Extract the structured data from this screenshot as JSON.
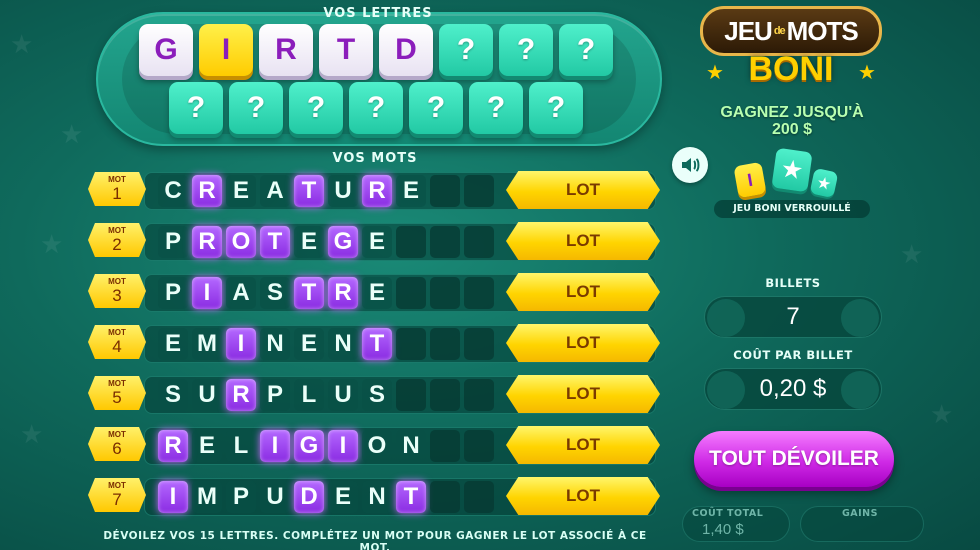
{
  "letters": {
    "title": "VOS LETTRES",
    "row1": [
      {
        "char": "G",
        "state": "revealed"
      },
      {
        "char": "I",
        "state": "gold"
      },
      {
        "char": "R",
        "state": "revealed"
      },
      {
        "char": "T",
        "state": "revealed"
      },
      {
        "char": "D",
        "state": "revealed"
      },
      {
        "char": "?",
        "state": "hidden"
      },
      {
        "char": "?",
        "state": "hidden"
      },
      {
        "char": "?",
        "state": "hidden"
      }
    ],
    "row2": [
      {
        "char": "?",
        "state": "hidden"
      },
      {
        "char": "?",
        "state": "hidden"
      },
      {
        "char": "?",
        "state": "hidden"
      },
      {
        "char": "?",
        "state": "hidden"
      },
      {
        "char": "?",
        "state": "hidden"
      },
      {
        "char": "?",
        "state": "hidden"
      },
      {
        "char": "?",
        "state": "hidden"
      }
    ]
  },
  "words": {
    "title": "VOS MOTS",
    "mot_label": "MOT",
    "lot_label": "LOT",
    "rows": [
      {
        "number": "1",
        "word": "CREATURE",
        "lit": [
          1,
          4,
          6
        ]
      },
      {
        "number": "2",
        "word": "PROTEGE",
        "lit": [
          1,
          2,
          3,
          5
        ]
      },
      {
        "number": "3",
        "word": "PIASTRE",
        "lit": [
          1,
          4,
          5
        ]
      },
      {
        "number": "4",
        "word": "EMINENT",
        "lit": [
          2,
          6
        ]
      },
      {
        "number": "5",
        "word": "SURPLUS",
        "lit": [
          2
        ]
      },
      {
        "number": "6",
        "word": "RELIGION",
        "lit": [
          0,
          3,
          4,
          5
        ]
      },
      {
        "number": "7",
        "word": "IMPUDENT",
        "lit": [
          0,
          4,
          7
        ]
      }
    ]
  },
  "instructions": "DÉVOILEZ VOS 15 LETTRES. COMPLÉTEZ UN MOT POUR GAGNER LE LOT ASSOCIÉ À CE MOT.",
  "logo": {
    "line1_a": "JEU",
    "line1_de": "de",
    "line1_b": "MOTS",
    "line2": "BONI"
  },
  "prize": {
    "line1": "GAGNEZ JUSQU'À",
    "line2": "200 $"
  },
  "bonus": {
    "label": "JEU BONI VERROUILLÉ"
  },
  "tickets": {
    "label": "BILLETS",
    "value": "7"
  },
  "cost": {
    "label": "COÛT PAR BILLET",
    "value": "0,20 $"
  },
  "reveal_button": "TOUT DÉVOILER",
  "total_cost": {
    "label": "COÛT TOTAL",
    "value": "1,40 $"
  },
  "winnings": {
    "label": "GAINS",
    "value": ""
  },
  "colors": {
    "purple": "#8b1dbb",
    "gold": "#ffd400",
    "teal": "#22c9a4",
    "background": "#0f6a5c"
  },
  "icons": {
    "sound": "speaker-icon",
    "bonus_star": "star-icon"
  }
}
